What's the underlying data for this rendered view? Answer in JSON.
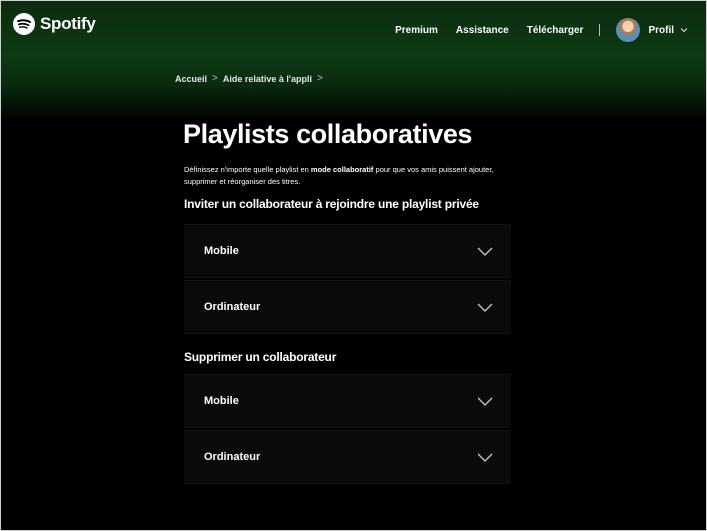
{
  "brand": {
    "name": "Spotify",
    "accent": "#1ed760"
  },
  "nav": {
    "premium": "Premium",
    "assistance": "Assistance",
    "download": "Télécharger",
    "profile": "Profil"
  },
  "breadcrumb": {
    "home": "Accueil",
    "section": "Aide relative à l'appli"
  },
  "page": {
    "title": "Playlists collaboratives",
    "intro_before": "Définissez n'importe quelle playlist en ",
    "intro_bold": "mode collaboratif",
    "intro_after": " pour que vos amis puissent ajouter, supprimer et réorganiser des titres."
  },
  "sections": [
    {
      "heading": "Inviter un collaborateur à rejoindre une playlist privée",
      "items": [
        "Mobile",
        "Ordinateur"
      ]
    },
    {
      "heading": "Supprimer un collaborateur",
      "items": [
        "Mobile",
        "Ordinateur"
      ]
    }
  ]
}
